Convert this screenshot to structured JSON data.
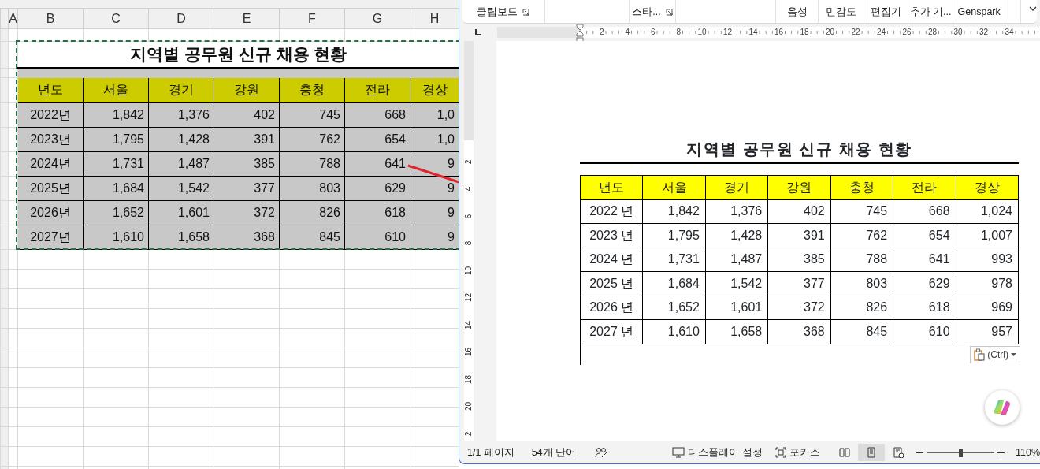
{
  "excel": {
    "column_headers": [
      "A",
      "B",
      "C",
      "D",
      "E",
      "F",
      "G",
      "H"
    ],
    "title": "지역별 공무원 신규 채용 현황",
    "columns": [
      "년도",
      "서울",
      "경기",
      "강원",
      "충청",
      "전라",
      "경상"
    ],
    "rows": [
      {
        "cells": [
          "2022년",
          "1,842",
          "1,376",
          "402",
          "745",
          "668",
          "1,0"
        ]
      },
      {
        "cells": [
          "2023년",
          "1,795",
          "1,428",
          "391",
          "762",
          "654",
          "1,0"
        ]
      },
      {
        "cells": [
          "2024년",
          "1,731",
          "1,487",
          "385",
          "788",
          "641",
          "9"
        ]
      },
      {
        "cells": [
          "2025년",
          "1,684",
          "1,542",
          "377",
          "803",
          "629",
          "9"
        ]
      },
      {
        "cells": [
          "2026년",
          "1,652",
          "1,601",
          "372",
          "826",
          "618",
          "9"
        ]
      },
      {
        "cells": [
          "2027년",
          "1,610",
          "1,658",
          "368",
          "845",
          "610",
          "9"
        ]
      }
    ]
  },
  "word": {
    "ribbon_groups": [
      {
        "label": "클립보드",
        "launcher": true
      },
      {
        "label": "스타...",
        "launcher": true
      },
      {
        "label": "음성",
        "launcher": false
      },
      {
        "label": "민감도",
        "launcher": false
      },
      {
        "label": "편집기",
        "launcher": false
      },
      {
        "label": "추가 기...",
        "launcher": false
      },
      {
        "label": "Genspark",
        "launcher": false
      }
    ],
    "ruler_numbers": [
      "2",
      "4",
      "6",
      "8",
      "10",
      "12",
      "14",
      "16",
      "18",
      "20",
      "22",
      "24",
      "26",
      "28",
      "30",
      "32",
      "34"
    ],
    "vertical_ruler_numbers": [
      "2",
      "4",
      "6",
      "8",
      "10",
      "12",
      "14",
      "16",
      "18",
      "20",
      "2"
    ],
    "title": "지역별 공무원 신규 채용 현황",
    "columns": [
      "년도",
      "서울",
      "경기",
      "강원",
      "충청",
      "전라",
      "경상"
    ],
    "rows": [
      {
        "cells": [
          "2022 년",
          "1,842",
          "1,376",
          "402",
          "745",
          "668",
          "1,024"
        ]
      },
      {
        "cells": [
          "2023 년",
          "1,795",
          "1,428",
          "391",
          "762",
          "654",
          "1,007"
        ]
      },
      {
        "cells": [
          "2024 년",
          "1,731",
          "1,487",
          "385",
          "788",
          "641",
          "993"
        ]
      },
      {
        "cells": [
          "2025 년",
          "1,684",
          "1,542",
          "377",
          "803",
          "629",
          "978"
        ]
      },
      {
        "cells": [
          "2026 년",
          "1,652",
          "1,601",
          "372",
          "826",
          "618",
          "969"
        ]
      },
      {
        "cells": [
          "2027 년",
          "1,610",
          "1,658",
          "368",
          "845",
          "610",
          "957"
        ]
      }
    ],
    "paste_button": "(Ctrl)",
    "status_bar": {
      "page": "1/1 페이지",
      "words": "54개 단어",
      "display": "디스플레이 설정",
      "focus": "포커스",
      "views": [
        {
          "kind": "read",
          "selected": false
        },
        {
          "kind": "print",
          "selected": true
        },
        {
          "kind": "web",
          "selected": false
        }
      ],
      "zoom": {
        "level": 0.5,
        "reading": "110%"
      }
    }
  }
}
